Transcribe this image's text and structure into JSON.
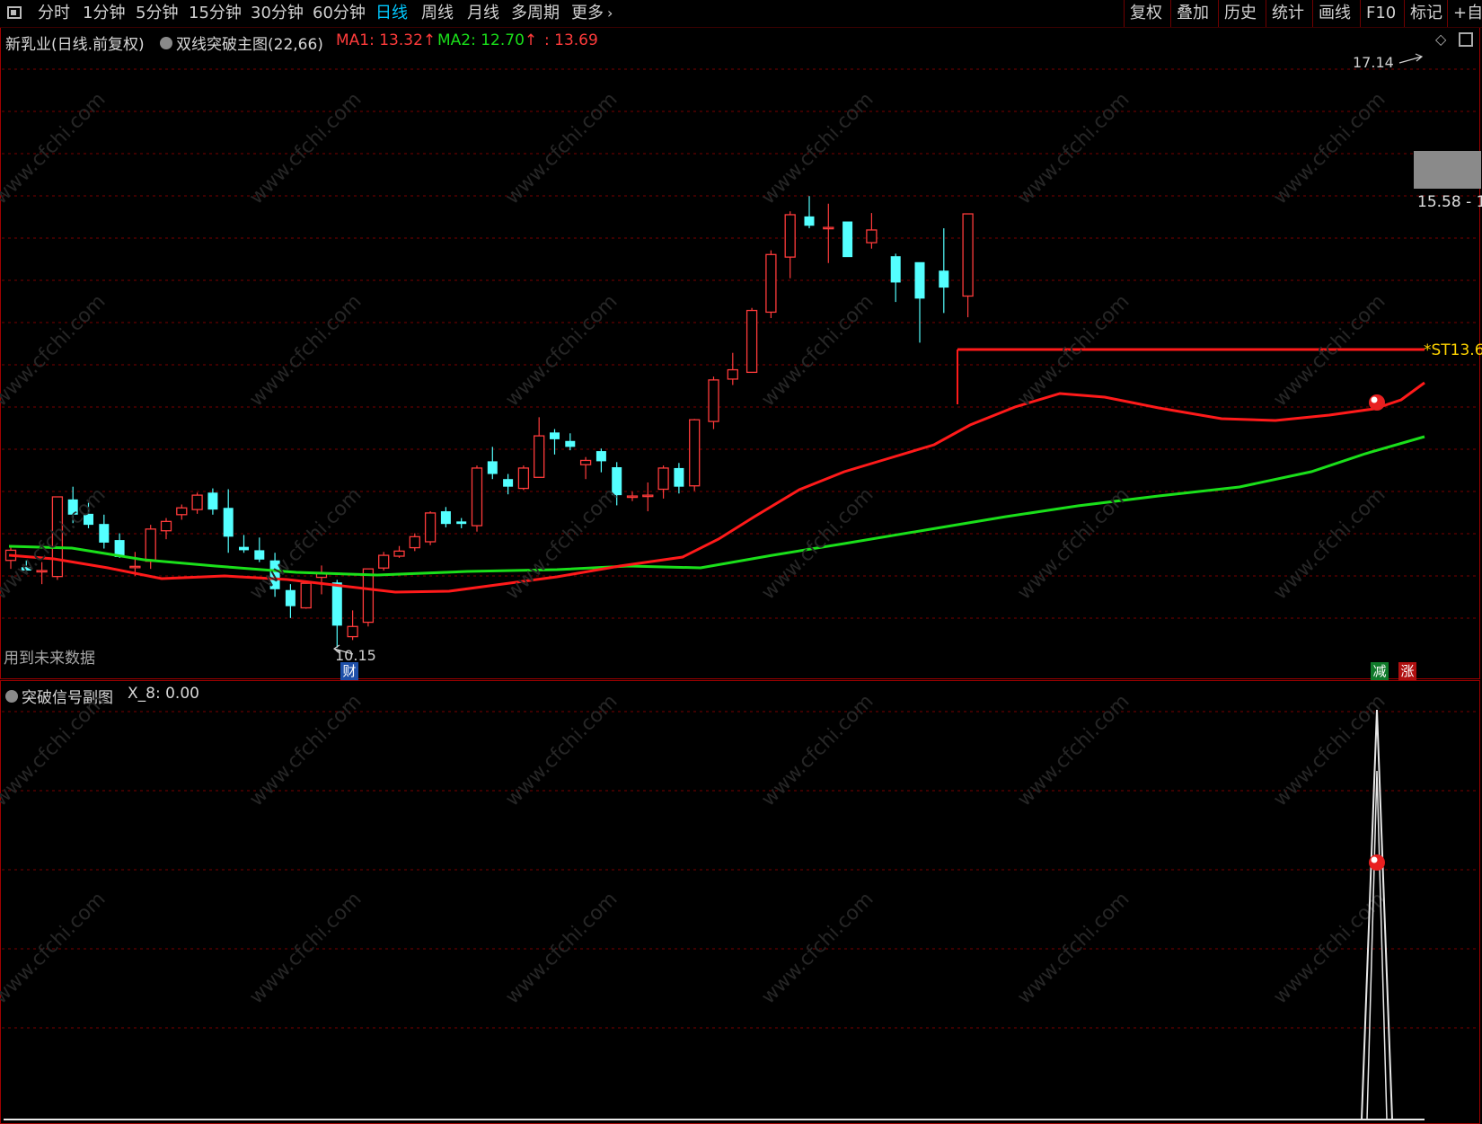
{
  "toolbar": {
    "tabs": [
      "分时",
      "1分钟",
      "5分钟",
      "15分钟",
      "30分钟",
      "60分钟",
      "日线",
      "周线",
      "月线",
      "多周期",
      "更多"
    ],
    "active_tab": "日线",
    "right_buttons": [
      "复权",
      "叠加",
      "历史",
      "统计",
      "画线",
      "F10",
      "标记",
      "+自"
    ]
  },
  "main": {
    "stock_title": "新乳业(日线.前复权)",
    "indicator_name": "双线突破主图(22,66)",
    "ma1_label": "MA1: 13.32",
    "ma2_label": "MA2: 12.70",
    "extra_value": ": 13.69",
    "high_label": "17.14",
    "low_label": "10.15",
    "price_box_label": "15.58 - 1",
    "st_label": "*ST13.6",
    "future_data_note": "用到未来数据",
    "badge_cai": "财",
    "badge_jian": "减",
    "badge_zhang": "涨"
  },
  "sub": {
    "indicator_name": "突破信号副图",
    "x8_label": "X_8: 0.00"
  },
  "colors": {
    "up": "#ff3b3b",
    "down": "#54ffff",
    "ma1": "#ff1a1a",
    "ma2": "#1adf1a",
    "grid": "#7a0000",
    "watermark": "#2a2a2a"
  },
  "chart_data": {
    "type": "candlestick",
    "candles": [
      [
        11.18,
        11.34,
        11.08,
        11.3
      ],
      [
        11.1,
        11.18,
        11.02,
        11.06
      ],
      [
        11.05,
        11.16,
        10.9,
        11.06
      ],
      [
        10.99,
        11.93,
        10.95,
        11.93
      ],
      [
        11.9,
        12.05,
        11.62,
        11.72
      ],
      [
        11.73,
        11.86,
        11.56,
        11.6
      ],
      [
        11.61,
        11.72,
        11.32,
        11.39
      ],
      [
        11.42,
        11.5,
        11.21,
        11.22
      ],
      [
        11.11,
        11.28,
        11.0,
        11.11
      ],
      [
        11.17,
        11.6,
        11.08,
        11.55
      ],
      [
        11.53,
        11.68,
        11.43,
        11.64
      ],
      [
        11.72,
        11.84,
        11.66,
        11.8
      ],
      [
        11.78,
        11.98,
        11.73,
        11.95
      ],
      [
        11.98,
        12.03,
        11.72,
        11.78
      ],
      [
        11.8,
        12.02,
        11.27,
        11.46
      ],
      [
        11.34,
        11.48,
        11.27,
        11.3
      ],
      [
        11.3,
        11.45,
        11.16,
        11.19
      ],
      [
        11.18,
        11.27,
        10.75,
        10.84
      ],
      [
        10.83,
        10.9,
        10.5,
        10.64
      ],
      [
        10.62,
        10.94,
        10.61,
        10.91
      ],
      [
        10.98,
        11.12,
        10.78,
        11.03
      ],
      [
        10.92,
        10.95,
        10.15,
        10.41
      ],
      [
        10.28,
        10.59,
        10.24,
        10.4
      ],
      [
        10.45,
        11.08,
        10.4,
        11.08
      ],
      [
        11.09,
        11.28,
        11.06,
        11.24
      ],
      [
        11.23,
        11.35,
        11.21,
        11.29
      ],
      [
        11.33,
        11.5,
        11.29,
        11.46
      ],
      [
        11.4,
        11.76,
        11.36,
        11.74
      ],
      [
        11.76,
        11.81,
        11.57,
        11.61
      ],
      [
        11.64,
        11.68,
        11.56,
        11.61
      ],
      [
        11.59,
        12.3,
        11.52,
        12.27
      ],
      [
        12.35,
        12.52,
        12.14,
        12.2
      ],
      [
        12.14,
        12.2,
        11.96,
        12.05
      ],
      [
        12.03,
        12.3,
        12.01,
        12.27
      ],
      [
        12.16,
        12.87,
        12.16,
        12.65
      ],
      [
        12.69,
        12.73,
        12.43,
        12.61
      ],
      [
        12.59,
        12.68,
        12.48,
        12.52
      ],
      [
        12.31,
        12.4,
        12.14,
        12.36
      ],
      [
        12.47,
        12.5,
        12.22,
        12.35
      ],
      [
        12.28,
        12.34,
        11.83,
        11.95
      ],
      [
        11.94,
        11.99,
        11.88,
        11.94
      ],
      [
        11.94,
        12.1,
        11.76,
        11.95
      ],
      [
        12.02,
        12.3,
        11.91,
        12.27
      ],
      [
        12.27,
        12.33,
        11.97,
        12.05
      ],
      [
        12.06,
        12.85,
        12.0,
        12.84
      ],
      [
        12.82,
        13.35,
        12.73,
        13.31
      ],
      [
        13.32,
        13.63,
        13.25,
        13.43
      ],
      [
        13.4,
        14.16,
        13.41,
        14.13
      ],
      [
        14.11,
        14.84,
        14.04,
        14.79
      ],
      [
        14.76,
        15.3,
        14.51,
        15.26
      ],
      [
        15.24,
        15.48,
        15.1,
        15.13
      ],
      [
        15.11,
        15.39,
        14.69,
        15.11
      ],
      [
        15.18,
        15.14,
        14.91,
        14.76
      ],
      [
        14.93,
        15.28,
        14.86,
        15.08
      ],
      [
        14.77,
        14.8,
        14.23,
        14.46
      ],
      [
        14.7,
        14.35,
        13.75,
        14.27
      ],
      [
        14.6,
        15.1,
        14.1,
        14.4
      ],
      [
        14.3,
        15.1,
        14.05,
        15.27
      ]
    ]
  }
}
